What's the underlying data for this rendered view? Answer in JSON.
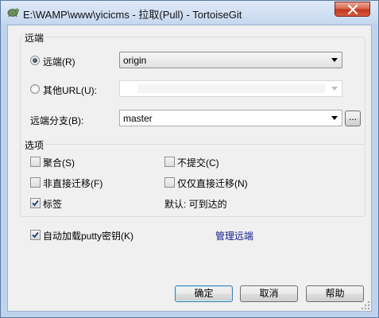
{
  "window": {
    "title": "E:\\WAMP\\www\\yicicms - 拉取(Pull) - TortoiseGit"
  },
  "remote_group": {
    "title": "远端",
    "remote_radio_label": "远端(R)",
    "remote_value": "origin",
    "other_url_label": "其他URL(U):",
    "other_url_value": "",
    "branch_label": "远端分支(B):",
    "branch_value": "master",
    "browse_label": "..."
  },
  "options_group": {
    "title": "选项",
    "squash_label": "聚合(S)",
    "no_commit_label": "不提交(C)",
    "no_ff_label": "非直接迁移(F)",
    "ff_only_label": "仅仅直接迁移(N)",
    "tags_label": "标签",
    "tags_hint": "默认: 可到达的",
    "tags_checked": true
  },
  "autoload_putty_label": "自动加载putty密钥(K)",
  "autoload_putty_checked": true,
  "manage_remotes_link": "管理远端",
  "buttons": {
    "ok": "确定",
    "cancel": "取消",
    "help": "帮助"
  }
}
